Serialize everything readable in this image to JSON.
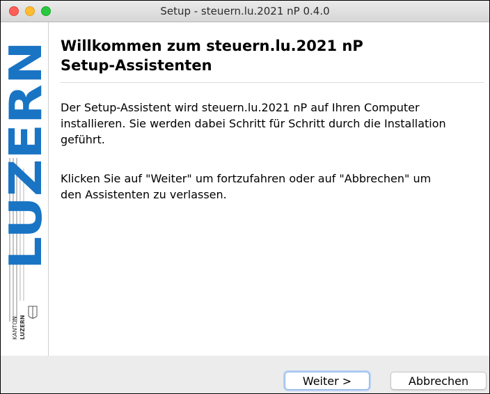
{
  "window": {
    "title": "Setup - steuern.lu.2021 nP 0.4.0"
  },
  "sidebar": {
    "logo_word": "LUZERN",
    "logo_small_top": "KANTON",
    "logo_small_bottom": "LUZERN"
  },
  "content": {
    "heading_line1": "Willkommen zum steuern.lu.2021 nP",
    "heading_line2": "Setup-Assistenten",
    "paragraph1_line1": "Der Setup-Assistent wird steuern.lu.2021 nP auf Ihren Computer",
    "paragraph1_line2": "installieren. Sie werden dabei Schritt für Schritt durch die Installation",
    "paragraph1_line3": "geführt.",
    "paragraph2_line1": "Klicken Sie auf \"Weiter\" um fortzufahren oder auf \"Abbrechen\" um",
    "paragraph2_line2": "den Assistenten zu verlassen."
  },
  "buttons": {
    "next_label": "Weiter >",
    "cancel_label": "Abbrechen"
  },
  "colors": {
    "brand_blue": "#1a74c4"
  },
  "icons": [
    "close-icon",
    "minimize-icon",
    "zoom-icon",
    "kanton-luzern-logo"
  ]
}
